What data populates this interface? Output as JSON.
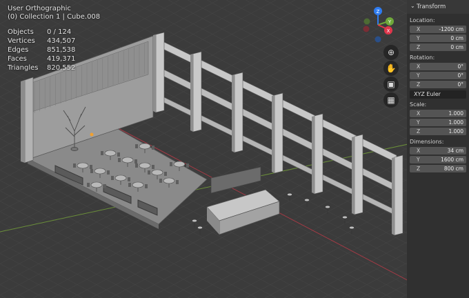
{
  "viewport": {
    "view_name": "User Orthographic",
    "collection_info": "(0) Collection 1 | Cube.008",
    "stats": [
      {
        "label": "Objects",
        "value": "0 / 124"
      },
      {
        "label": "Vertices",
        "value": "434,507"
      },
      {
        "label": "Edges",
        "value": "851,538"
      },
      {
        "label": "Faces",
        "value": "419,371"
      },
      {
        "label": "Triangles",
        "value": "820,552"
      }
    ]
  },
  "gizmo": {
    "axes": [
      {
        "name": "Z",
        "color": "#2f7cf0"
      },
      {
        "name": "Y",
        "color": "#6fa83a"
      },
      {
        "name": "X",
        "color": "#e0364c"
      }
    ],
    "buttons": [
      "zoom-icon",
      "hand-icon",
      "camera-icon",
      "grid-icon"
    ]
  },
  "sidebar": {
    "panel_title": "Transform",
    "location": {
      "label": "Location:",
      "fields": [
        {
          "axis": "X",
          "value": "-1200 cm"
        },
        {
          "axis": "Y",
          "value": "0 cm"
        },
        {
          "axis": "Z",
          "value": "0 cm"
        }
      ]
    },
    "rotation": {
      "label": "Rotation:",
      "fields": [
        {
          "axis": "X",
          "value": "0°"
        },
        {
          "axis": "Y",
          "value": "0°"
        },
        {
          "axis": "Z",
          "value": "0°"
        }
      ],
      "mode": "XYZ Euler"
    },
    "scale": {
      "label": "Scale:",
      "fields": [
        {
          "axis": "X",
          "value": "1.000"
        },
        {
          "axis": "Y",
          "value": "1.000"
        },
        {
          "axis": "Z",
          "value": "1.000"
        }
      ]
    },
    "dimensions": {
      "label": "Dimensions:",
      "fields": [
        {
          "axis": "X",
          "value": "34 cm"
        },
        {
          "axis": "Y",
          "value": "1600 cm"
        },
        {
          "axis": "Z",
          "value": "800 cm"
        }
      ]
    }
  }
}
